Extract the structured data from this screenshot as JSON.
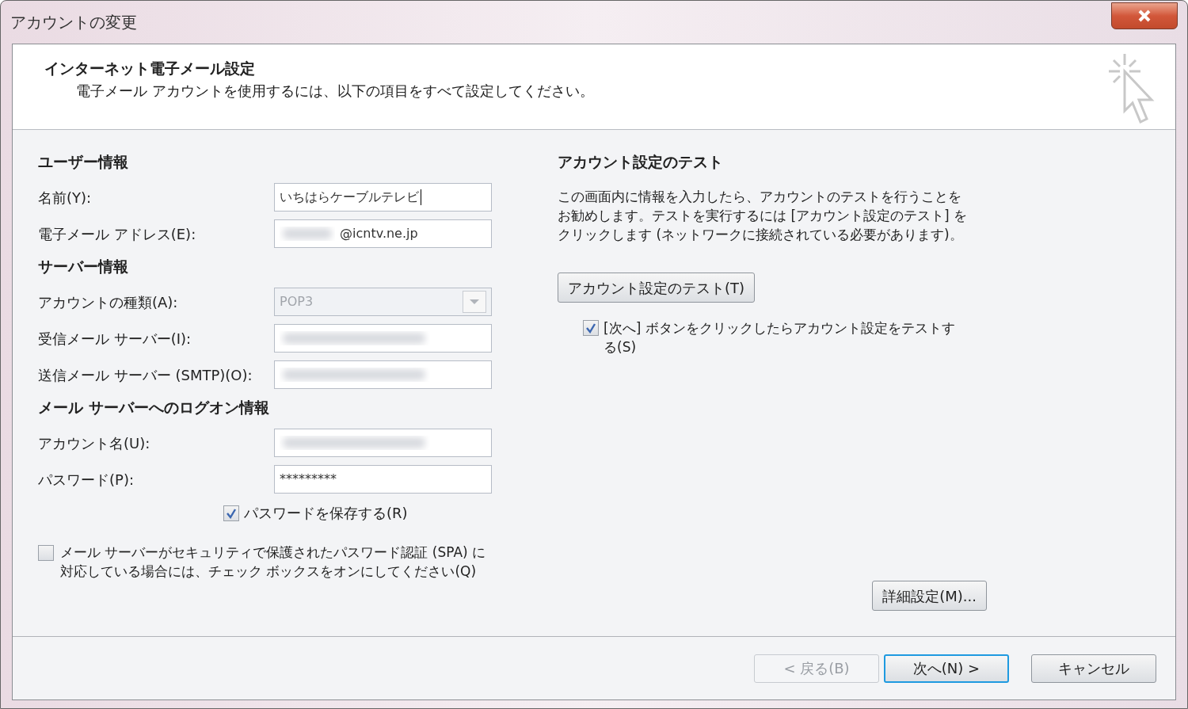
{
  "window": {
    "title": "アカウントの変更"
  },
  "header": {
    "title": "インターネット電子メール設定",
    "subtitle": "電子メール アカウントを使用するには、以下の項目をすべて設定してください。"
  },
  "sections": [
    {
      "heading": "ユーザー情報",
      "fields": [
        {
          "label": "名前(Y):",
          "kind": "text",
          "value": "いちはらケーブルテレビ",
          "focused": true,
          "blurred": false
        },
        {
          "label": "電子メール アドレス(E):",
          "kind": "text",
          "value": "@icntv.ne.jp",
          "focused": false,
          "blurred": true
        }
      ]
    },
    {
      "heading": "サーバー情報",
      "fields": [
        {
          "label": "アカウントの種類(A):",
          "kind": "select",
          "value": "POP3",
          "disabled": true
        },
        {
          "label": "受信メール サーバー(I):",
          "kind": "text",
          "focused": false,
          "blurred": true
        },
        {
          "label": "送信メール サーバー (SMTP)(O):",
          "kind": "text",
          "focused": false,
          "blurred": true
        }
      ]
    },
    {
      "heading": "メール サーバーへのログオン情報",
      "fields": [
        {
          "label": "アカウント名(U):",
          "kind": "text",
          "focused": false,
          "blurred": true
        },
        {
          "label": "パスワード(P):",
          "kind": "text",
          "value": "*********",
          "focused": false,
          "blurred": false
        }
      ]
    }
  ],
  "save_password": {
    "label": "パスワードを保存する(R)",
    "checked": true
  },
  "spa": {
    "label": "メール サーバーがセキュリティで保護されたパスワード認証 (SPA) に対応している場合には、チェック ボックスをオンにしてください(Q)",
    "checked": false
  },
  "test": {
    "heading": "アカウント設定のテスト",
    "description": "この画面内に情報を入力したら、アカウントのテストを行うことをお勧めします。テストを実行するには [アカウント設定のテスト] をクリックします (ネットワークに接続されている必要があります)。",
    "button": "アカウント設定のテスト(T)",
    "test_on_next": {
      "label": "[次へ] ボタンをクリックしたらアカウント設定をテストする(S)",
      "checked": true
    }
  },
  "advanced_button": "詳細設定(M)...",
  "footer_buttons": [
    {
      "label": "< 戻る(B)",
      "disabled": true,
      "default": false
    },
    {
      "label": "次へ(N) >",
      "disabled": false,
      "default": true
    },
    {
      "label": "キャンセル",
      "disabled": false,
      "default": false
    }
  ]
}
